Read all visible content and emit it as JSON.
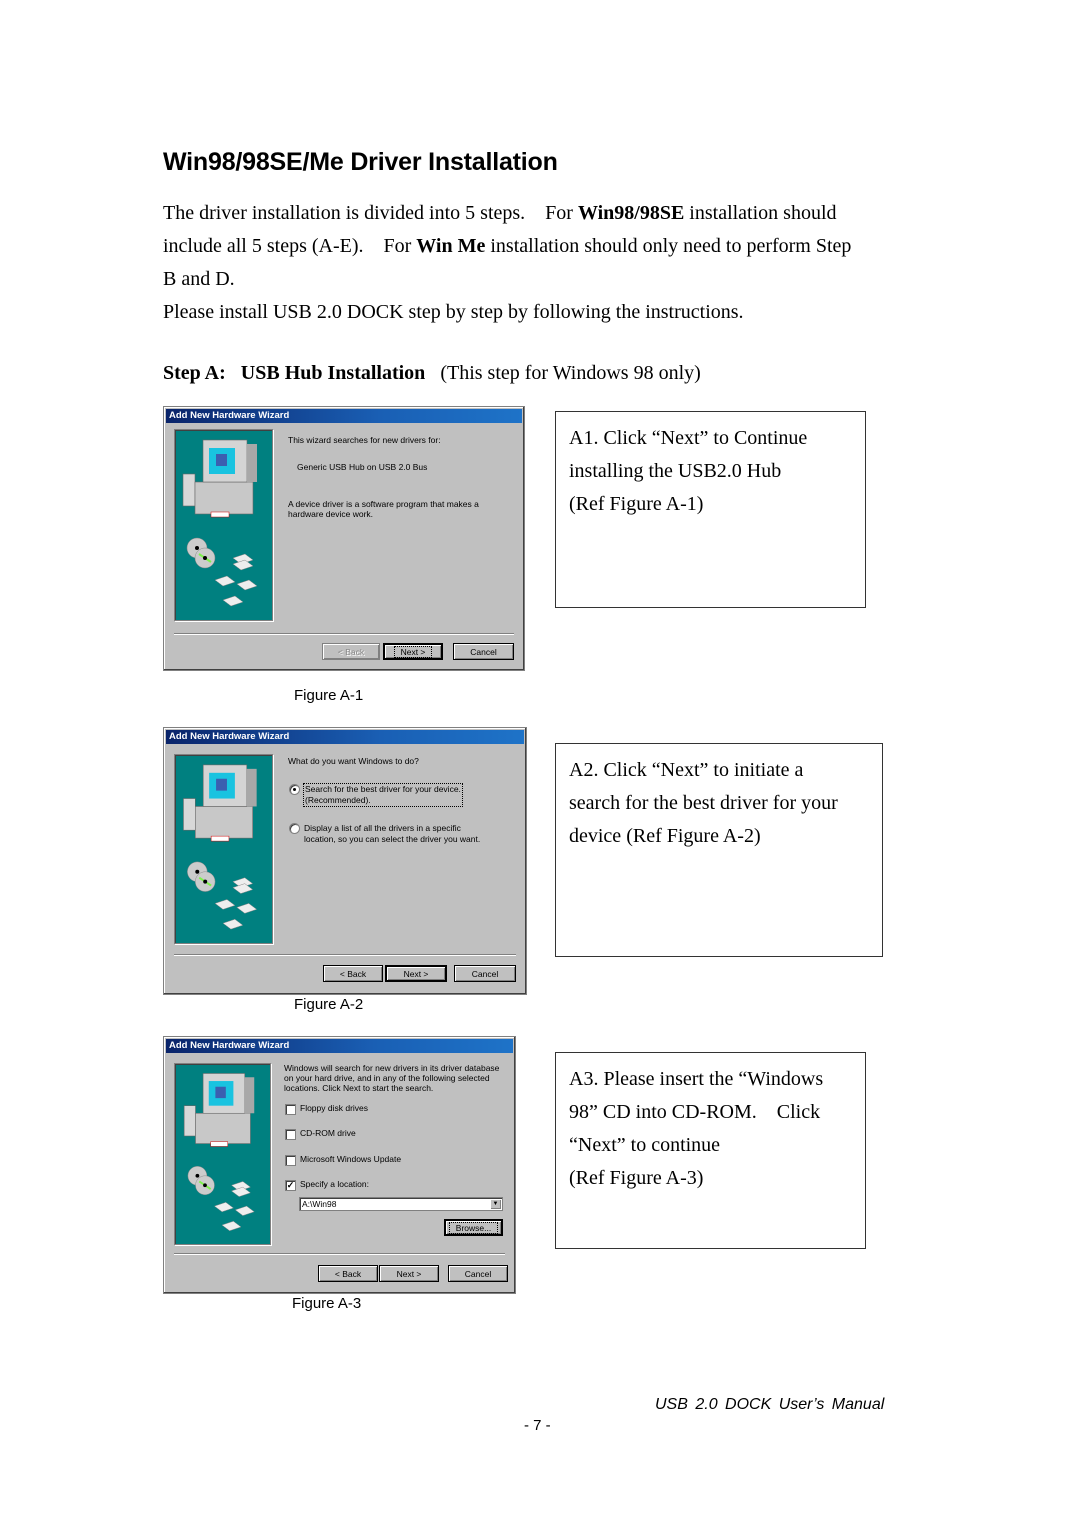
{
  "page": {
    "title": "Win98/98SE/Me Driver Installation",
    "intro": {
      "line1_a": "The driver installation is divided into 5 steps.    For ",
      "line1_bold": "Win98/98SE",
      "line1_b": " installation should",
      "line2_a": "include all 5 steps (A-E).    For ",
      "line2_bold": "Win Me",
      "line2_b": " installation should only need to perform Step",
      "line3": "B and D.",
      "line4": "Please install USB 2.0 DOCK step by step by following the instructions."
    },
    "step_heading": {
      "label": "Step A:",
      "title": "USB Hub Installation",
      "note": "(This step for Windows 98 only)"
    },
    "footer": {
      "manual_title": "USB 2.0 DOCK User’s Manual",
      "page_number": "- 7 -"
    }
  },
  "figures": [
    {
      "caption": "Figure A-1",
      "dialog": {
        "title": "Add New Hardware Wizard",
        "text1": "This wizard searches for new drivers for:",
        "device": "Generic USB Hub on USB 2.0 Bus",
        "text2a": "A device driver is a software program that makes a",
        "text2b": "hardware device work.",
        "buttons": {
          "back": "< Back",
          "next": "Next >",
          "cancel": "Cancel"
        },
        "back_disabled": true
      },
      "note": [
        "A1. Click “Next” to Continue",
        "installing the USB2.0 Hub",
        "(Ref Figure A-1)"
      ]
    },
    {
      "caption": "Figure A-2",
      "dialog": {
        "title": "Add New Hardware Wizard",
        "question": "What do you want Windows to do?",
        "options": [
          {
            "line1": "Search for the best driver for your device.",
            "line2": "(Recommended).",
            "selected": true
          },
          {
            "line1": "Display a list of all the drivers in a specific",
            "line2": "location, so you can select the driver you want.",
            "selected": false
          }
        ],
        "buttons": {
          "back": "< Back",
          "next": "Next >",
          "cancel": "Cancel"
        }
      },
      "note": [
        "A2. Click “Next” to initiate a",
        "search for the best driver for your",
        "device (Ref Figure A-2)"
      ]
    },
    {
      "caption": "Figure A-3",
      "dialog": {
        "title": "Add New Hardware Wizard",
        "text_lines": [
          "Windows will search for new drivers in its driver database",
          "on your hard drive, and in any of the following selected",
          "locations. Click Next to start the search."
        ],
        "checkboxes": [
          {
            "label": "Floppy disk drives",
            "checked": false
          },
          {
            "label": "CD-ROM drive",
            "checked": false
          },
          {
            "label": "Microsoft Windows Update",
            "checked": false
          },
          {
            "label": "Specify a location:",
            "checked": true
          }
        ],
        "location_value": "A:\\Win98",
        "browse": "Browse...",
        "buttons": {
          "back": "< Back",
          "next": "Next >",
          "cancel": "Cancel"
        }
      },
      "note": [
        "A3. Please insert the “Windows",
        "98” CD into CD-ROM.    Click",
        "“Next” to continue",
        "(Ref Figure A-3)"
      ]
    }
  ],
  "colors": {
    "titlebar_start": "#0a246a",
    "titlebar_end": "#1e73c8",
    "dialog_face": "#c0c0c0",
    "wizard_panel": "#008080"
  },
  "icons": {
    "wizard_illustration": "computer-with-discs-icon"
  }
}
